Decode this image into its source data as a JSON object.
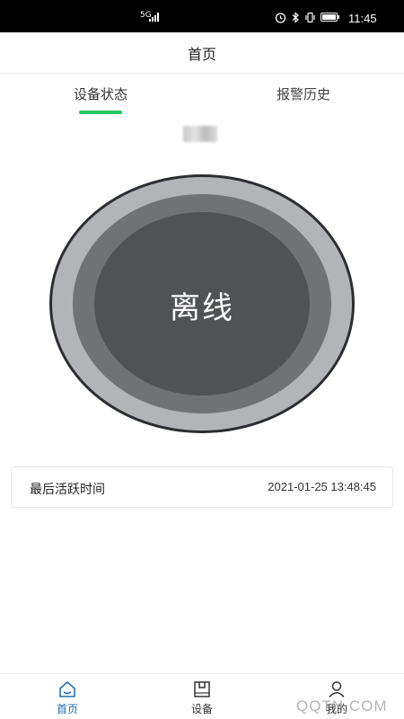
{
  "status_bar": {
    "network": "5G",
    "time": "11:45",
    "icons": [
      "alarm-icon",
      "bluetooth-icon",
      "vibrate-icon",
      "battery-icon"
    ]
  },
  "header": {
    "title": "首页"
  },
  "tabs": [
    {
      "label": "设备状态",
      "active": true
    },
    {
      "label": "报警历史",
      "active": false
    }
  ],
  "accent_color": "#22c55e",
  "device": {
    "status_label": "离线",
    "colors": {
      "outer_ring": "#b3b4b7",
      "middle_ring": "#707276",
      "inner_disc": "#505256",
      "edge": "#2c2d30"
    }
  },
  "last_active": {
    "label": "最后活跃时间",
    "value": "2021-01-25 13:48:45"
  },
  "bottom_nav": [
    {
      "label": "首页",
      "icon": "home-icon",
      "active": true
    },
    {
      "label": "设备",
      "icon": "device-icon",
      "active": false
    },
    {
      "label": "我的",
      "icon": "user-icon",
      "active": false
    }
  ],
  "watermark": "QQTN.COM"
}
